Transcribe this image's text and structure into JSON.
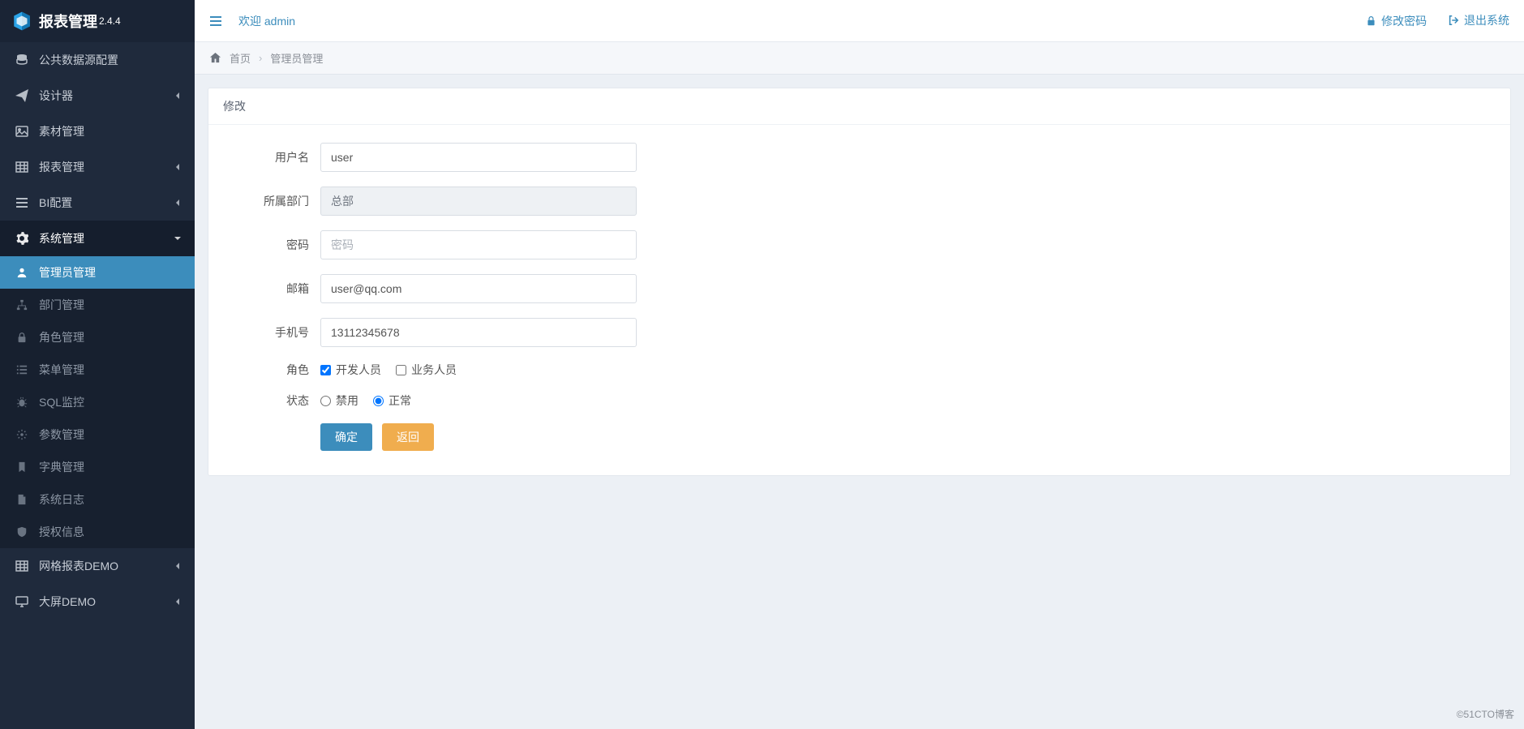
{
  "brand": {
    "title": "报表管理",
    "version": "2.4.4"
  },
  "topbar": {
    "welcome": "欢迎 admin",
    "change_password": "修改密码",
    "logout": "退出系统"
  },
  "breadcrumb": {
    "home": "首页",
    "current": "管理员管理"
  },
  "sidebar": {
    "items": [
      {
        "label": "公共数据源配置"
      },
      {
        "label": "设计器"
      },
      {
        "label": "素材管理"
      },
      {
        "label": "报表管理"
      },
      {
        "label": "BI配置"
      },
      {
        "label": "系统管理"
      },
      {
        "label": "网格报表DEMO"
      },
      {
        "label": "大屏DEMO"
      }
    ],
    "system_submenu": [
      {
        "label": "管理员管理"
      },
      {
        "label": "部门管理"
      },
      {
        "label": "角色管理"
      },
      {
        "label": "菜单管理"
      },
      {
        "label": "SQL监控"
      },
      {
        "label": "参数管理"
      },
      {
        "label": "字典管理"
      },
      {
        "label": "系统日志"
      },
      {
        "label": "授权信息"
      }
    ]
  },
  "panel": {
    "title": "修改"
  },
  "form": {
    "labels": {
      "username": "用户名",
      "department": "所属部门",
      "password": "密码",
      "email": "邮箱",
      "phone": "手机号",
      "role": "角色",
      "status": "状态"
    },
    "values": {
      "username": "user",
      "department": "总部",
      "email": "user@qq.com",
      "phone": "13112345678"
    },
    "placeholders": {
      "password": "密码"
    },
    "roles": {
      "dev": "开发人员",
      "biz": "业务人员"
    },
    "status": {
      "disabled": "禁用",
      "normal": "正常"
    },
    "buttons": {
      "submit": "确定",
      "back": "返回"
    }
  },
  "watermark": "©51CTO博客"
}
